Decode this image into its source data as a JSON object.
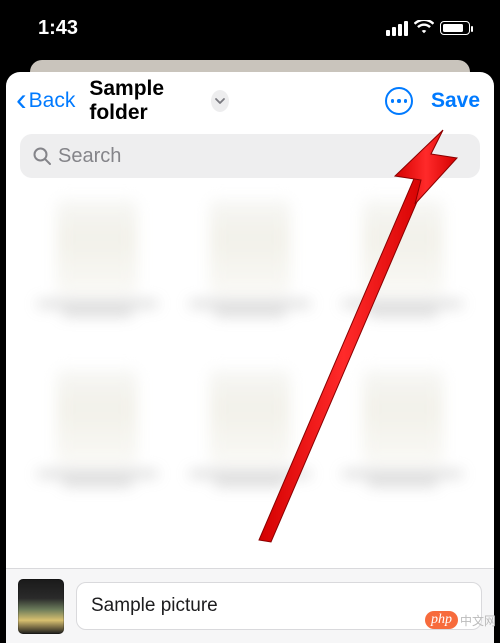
{
  "status_bar": {
    "time": "1:43"
  },
  "nav": {
    "back_label": "Back",
    "title": "Sample folder",
    "save_label": "Save"
  },
  "search": {
    "placeholder": "Search"
  },
  "footer": {
    "file_name": "Sample picture"
  },
  "watermark": {
    "brand": "php",
    "suffix": "中文网"
  }
}
